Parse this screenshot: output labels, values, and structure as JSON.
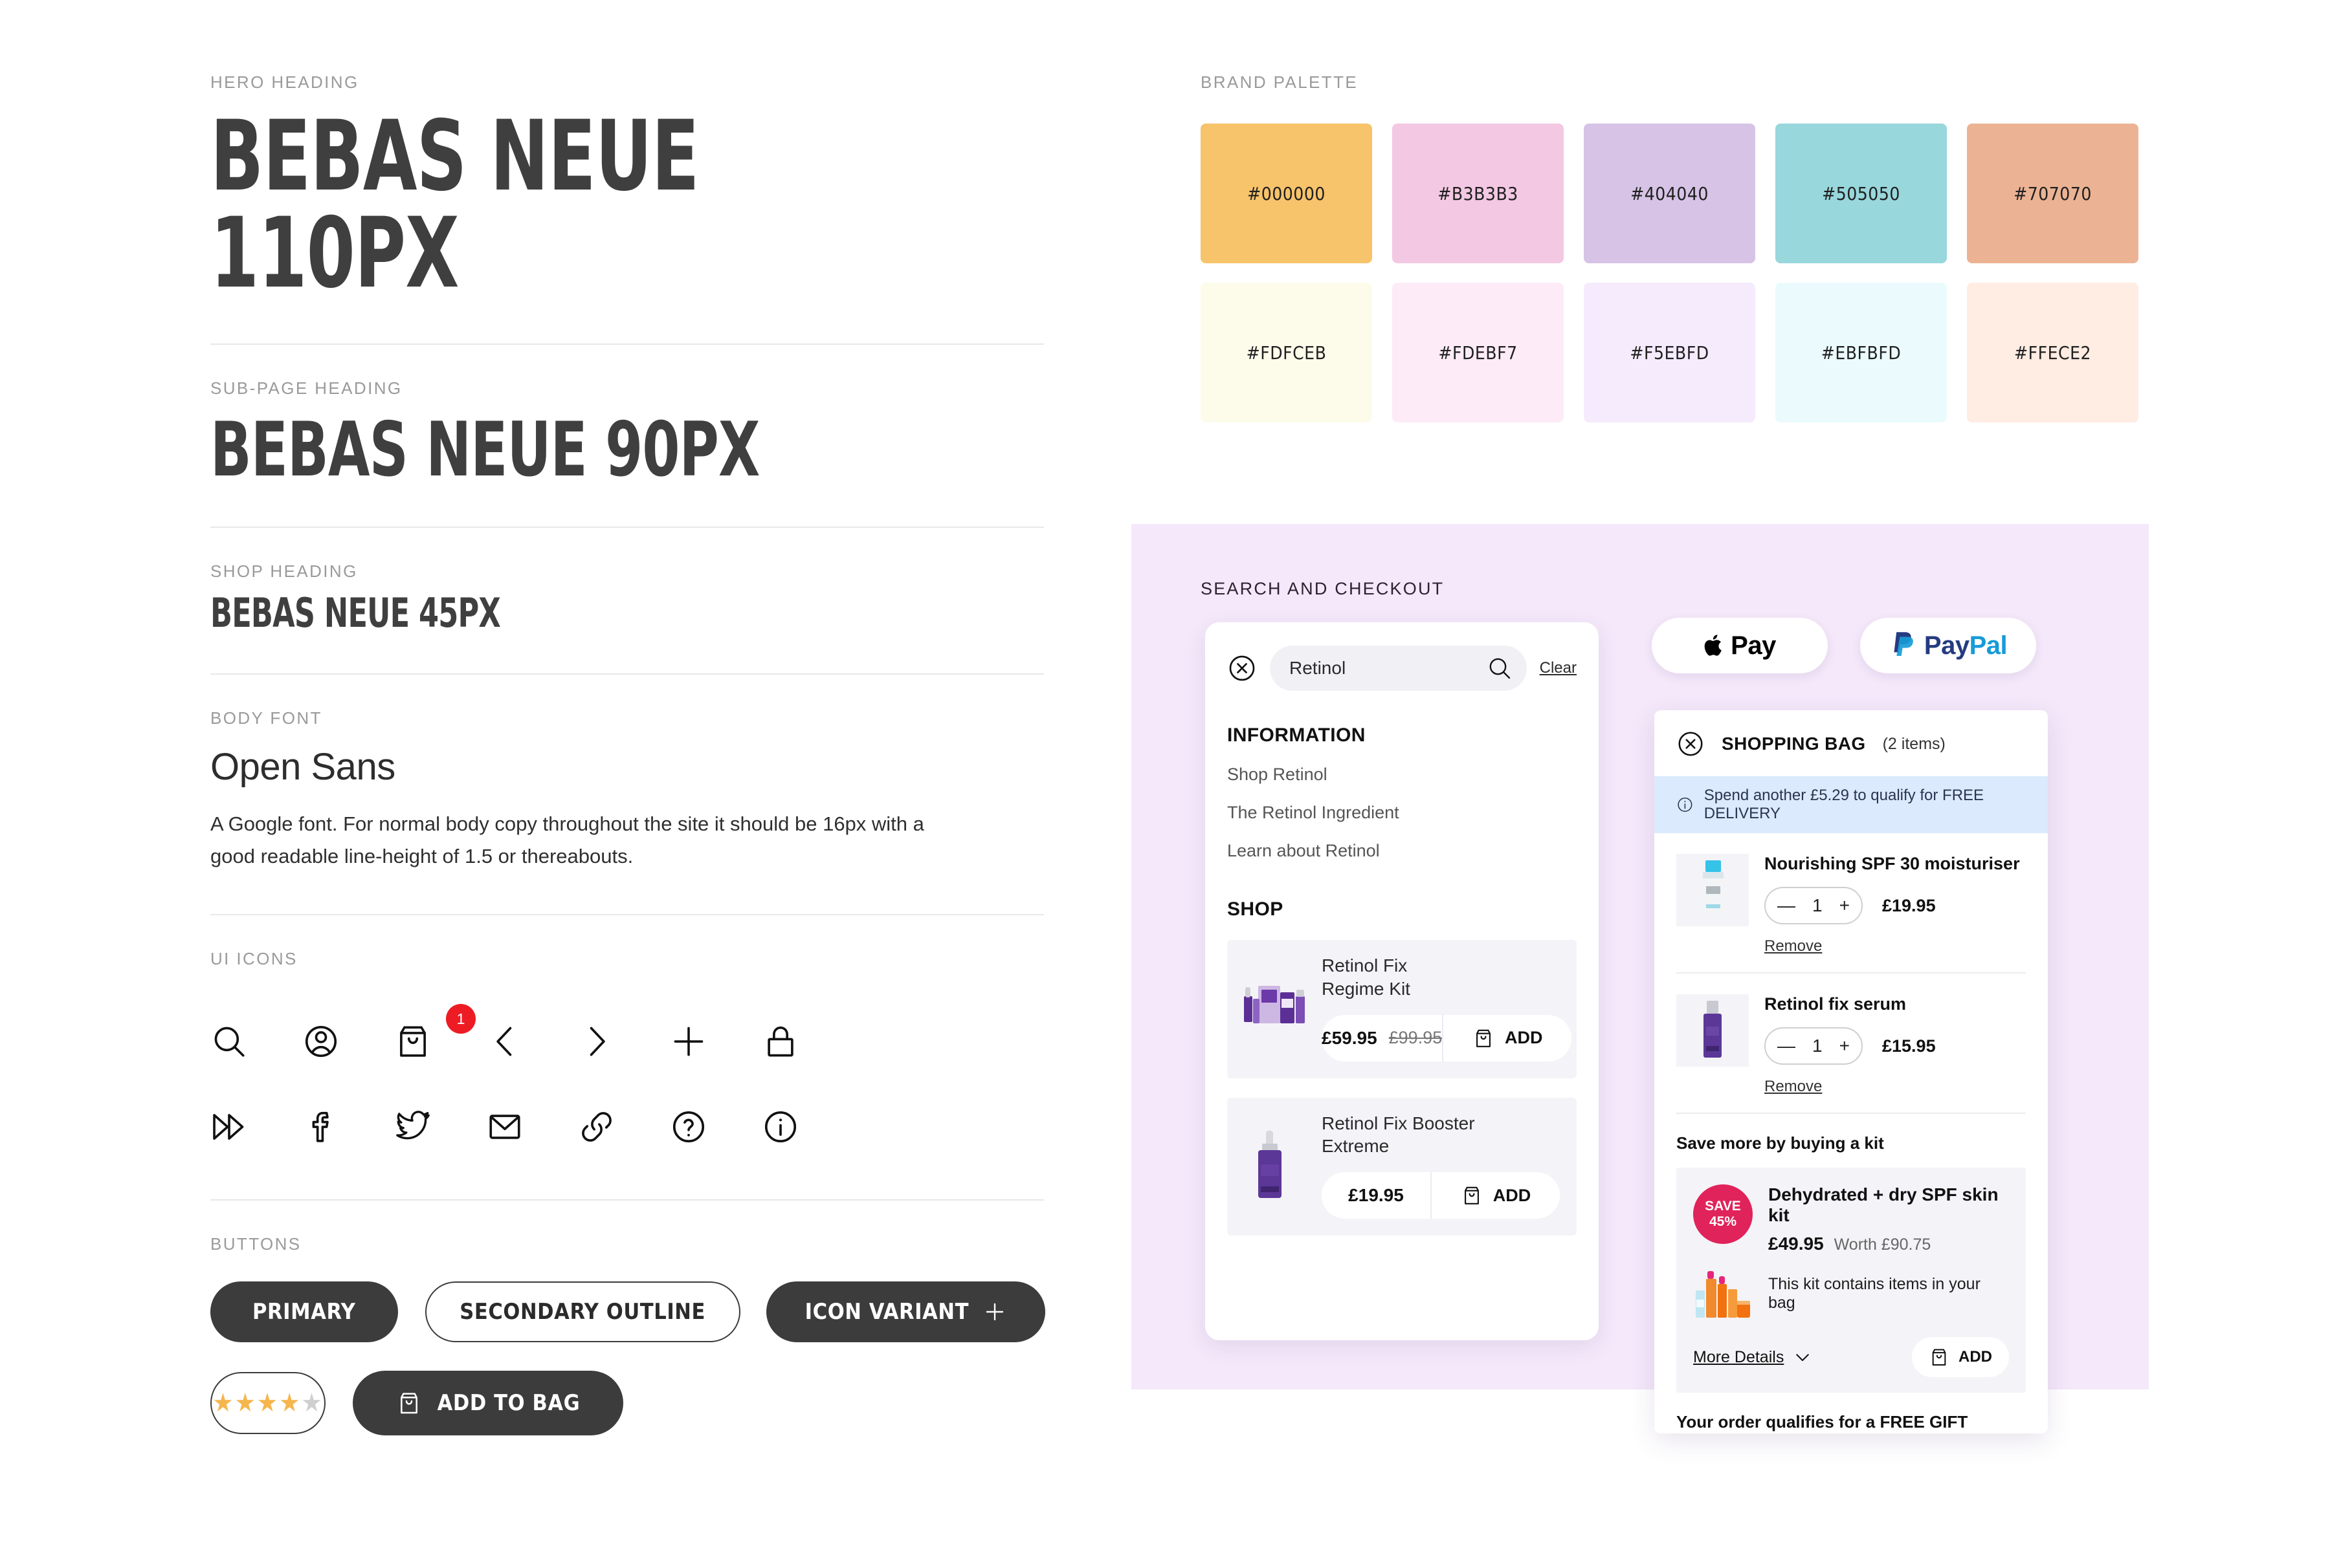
{
  "left": {
    "hero": {
      "label": "HERO HEADING",
      "text": "BEBAS NEUE 110PX"
    },
    "subpage": {
      "label": "SUB-PAGE HEADING",
      "text": "BEBAS NEUE 90PX"
    },
    "shop": {
      "label": "SHOP HEADING",
      "text": "BEBAS NEUE 45PX"
    },
    "body": {
      "label": "BODY FONT",
      "name": "Open Sans",
      "copy": "A Google font.  For normal body copy throughout the site it should be 16px with a good readable line-height of 1.5 or thereabouts."
    },
    "icons": {
      "label": "UI ICONS",
      "badge_count": "1",
      "names": [
        "search-icon",
        "account-icon",
        "shopping-bag-icon",
        "chevron-left-icon",
        "chevron-right-icon",
        "plus-icon",
        "lock-icon",
        "fast-forward-icon",
        "facebook-icon",
        "twitter-icon",
        "mail-icon",
        "link-icon",
        "question-icon",
        "info-icon"
      ]
    },
    "buttons": {
      "label": "BUTTONS",
      "primary": "PRIMARY",
      "secondary": "SECONDARY OUTLINE",
      "icon_variant": "ICON VARIANT",
      "add_to_bag": "ADD TO BAG",
      "rating_filled": 4,
      "rating_total": 5,
      "star_on_color": "#f5b64e",
      "star_off_color": "#cfcfcf"
    }
  },
  "palette": {
    "label": "BRAND PALETTE",
    "row1": [
      {
        "hex_label": "#000000",
        "swatch": "#f7c36b"
      },
      {
        "hex_label": "#B3B3B3",
        "swatch": "#f3c8e3"
      },
      {
        "hex_label": "#404040",
        "swatch": "#d6c3e6"
      },
      {
        "hex_label": "#505050",
        "swatch": "#98d7dc"
      },
      {
        "hex_label": "#707070",
        "swatch": "#ebb393"
      }
    ],
    "row2": [
      {
        "hex_label": "#FDFCEB",
        "swatch": "#fdfceb"
      },
      {
        "hex_label": "#FDEBF7",
        "swatch": "#fdebf7"
      },
      {
        "hex_label": "#F5EBFD",
        "swatch": "#f5ebfd"
      },
      {
        "hex_label": "#EBFBFD",
        "swatch": "#ebfbfd"
      },
      {
        "hex_label": "#FFECE2",
        "swatch": "#ffece2"
      }
    ]
  },
  "checkout": {
    "label": "SEARCH AND CHECKOUT",
    "panel_bg": "#f4e8fa",
    "search": {
      "value": "Retinol",
      "placeholder": "Search",
      "clear": "Clear",
      "information_heading": "INFORMATION",
      "information_links": [
        "Shop Retinol",
        "The Retinol Ingredient",
        "Learn about Retinol"
      ],
      "shop_heading": "SHOP",
      "products": [
        {
          "title": "Retinol Fix\nRegime Kit",
          "title_line1": "Retinol Fix",
          "title_line2": "Regime Kit",
          "price": "£59.95",
          "was_price": "£99.95",
          "add_label": "ADD"
        },
        {
          "title_line1": "Retinol Fix Booster",
          "title_line2": "Extreme",
          "price": "£19.95",
          "was_price": "",
          "add_label": "ADD"
        }
      ]
    },
    "payments": [
      {
        "name": "apple-pay",
        "label": "Pay"
      },
      {
        "name": "paypal",
        "label_1": "Pay",
        "label_2": "Pal"
      }
    ],
    "bag": {
      "title": "SHOPPING BAG",
      "count": "(2 items)",
      "delivery_notice": "Spend another £5.29 to qualify for FREE DELIVERY",
      "items": [
        {
          "name": "Nourishing SPF 30 moisturiser",
          "qty": "1",
          "price": "£19.95",
          "remove": "Remove"
        },
        {
          "name": "Retinol fix serum",
          "qty": "1",
          "price": "£15.95",
          "remove": "Remove"
        }
      ],
      "kit_heading": "Save more by buying a kit",
      "kit": {
        "save_line1": "SAVE",
        "save_line2": "45%",
        "name": "Dehydrated + dry SPF skin kit",
        "price": "£49.95",
        "worth": "Worth £90.75",
        "note": "This kit contains items in your bag",
        "more_details": "More Details",
        "add_label": "ADD"
      },
      "free_gift": "Your order qualifies for a FREE GIFT"
    }
  }
}
